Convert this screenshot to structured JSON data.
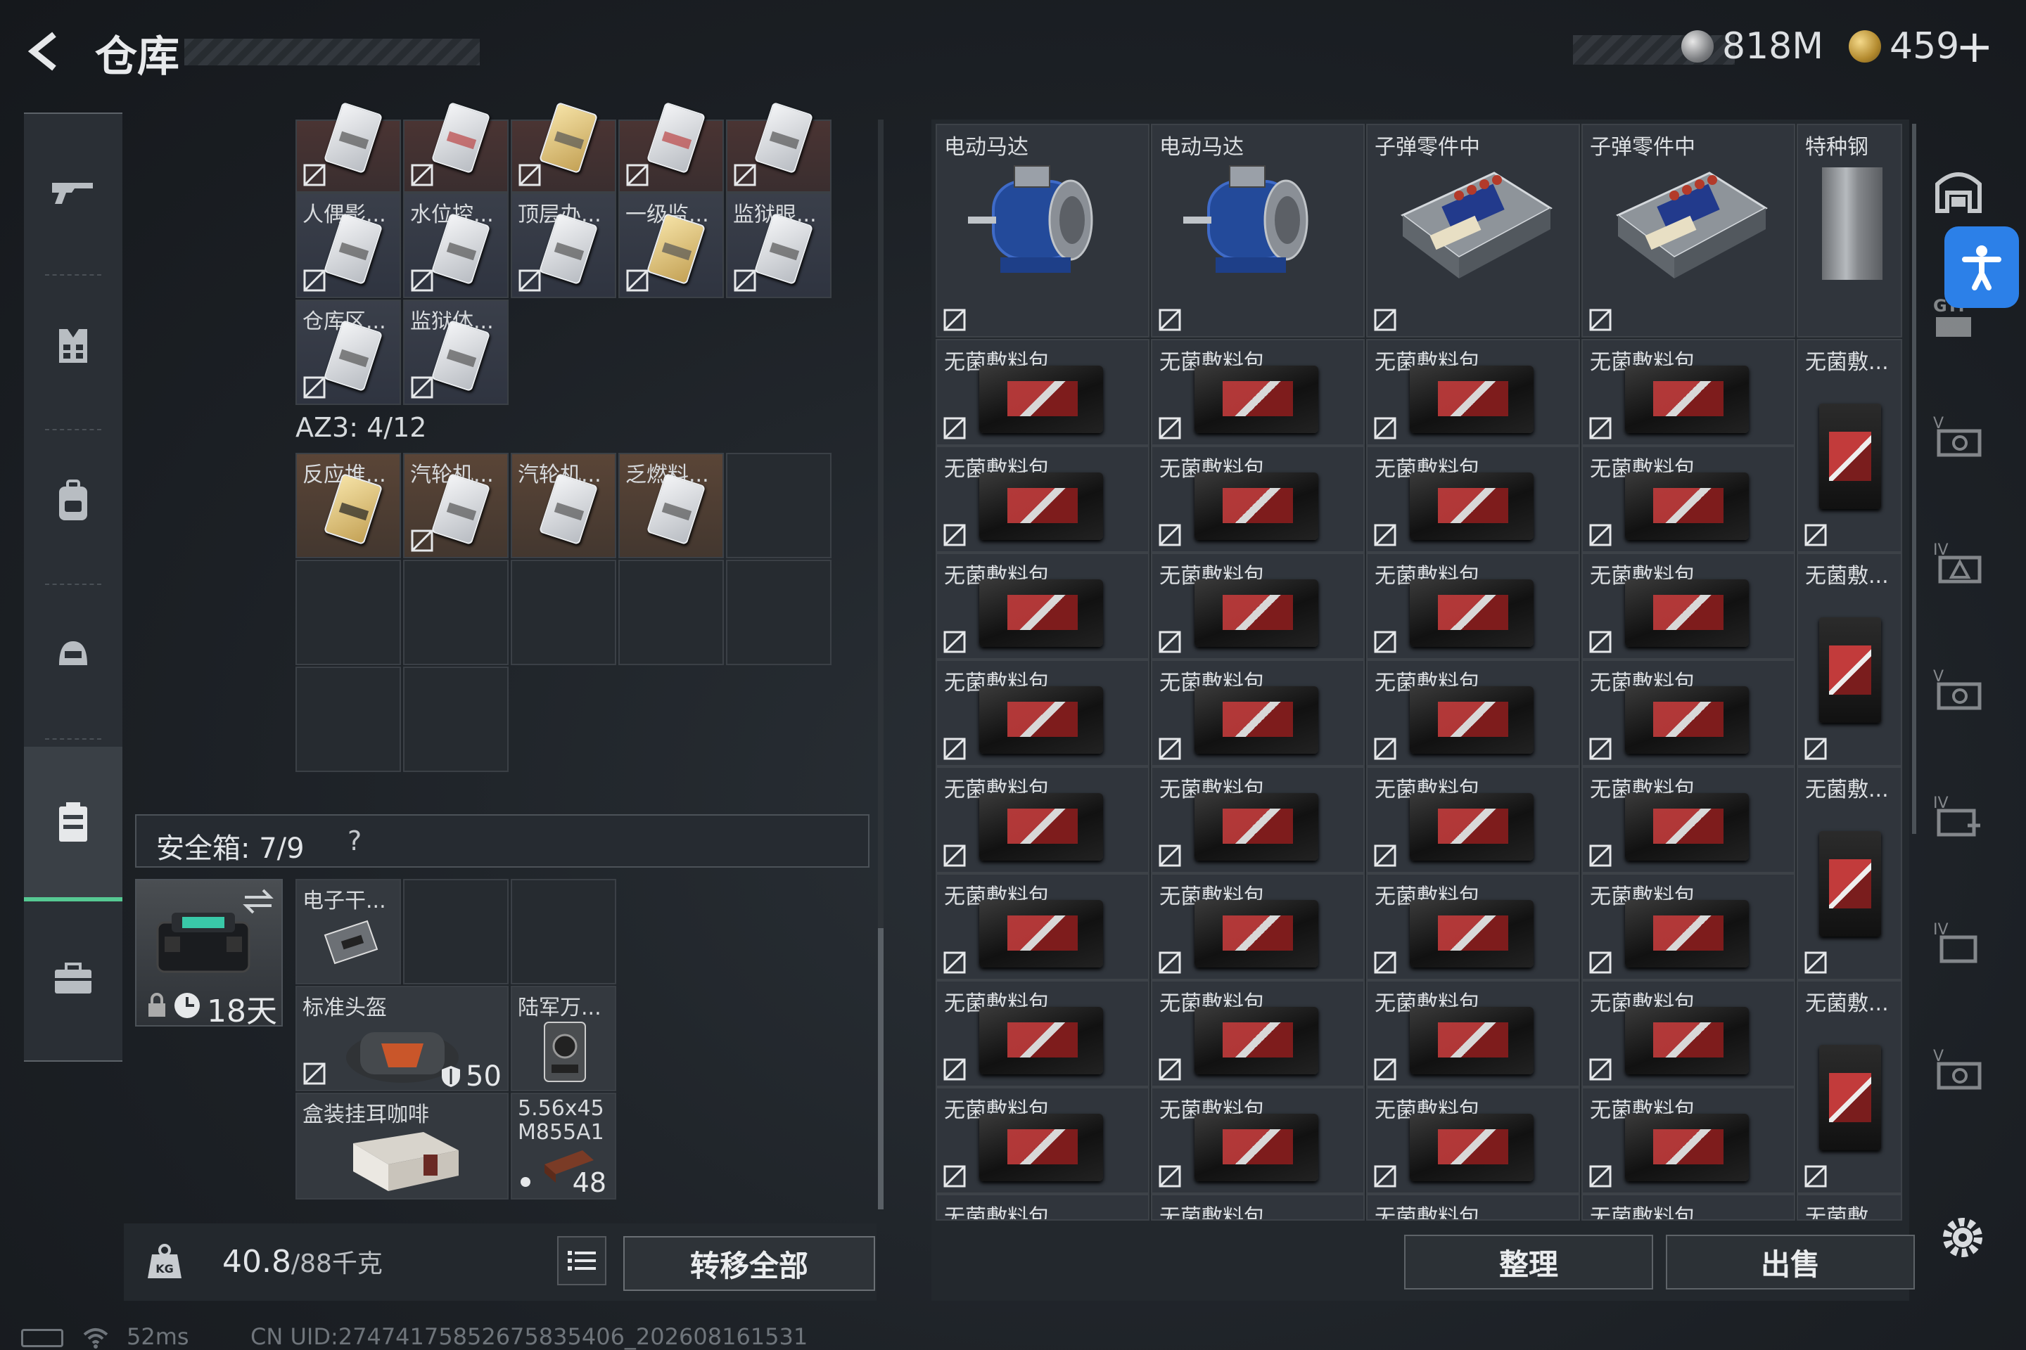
{
  "header": {
    "title": "仓库",
    "currency_silver": "818M",
    "currency_gold": "459",
    "add_label": "+"
  },
  "left_nav": {
    "items": [
      {
        "name": "weapons",
        "icon": "gun-icon"
      },
      {
        "name": "armor",
        "icon": "vest-icon"
      },
      {
        "name": "backpack",
        "icon": "backpack-icon"
      },
      {
        "name": "helmet",
        "icon": "helmet-icon"
      },
      {
        "name": "storage",
        "icon": "container-icon",
        "active": true
      },
      {
        "name": "briefcase",
        "icon": "briefcase-icon"
      }
    ]
  },
  "keycards_grid": {
    "rows": [
      [
        {
          "label": "",
          "style": "red"
        },
        {
          "label": "",
          "style": "red"
        },
        {
          "label": "",
          "style": "red"
        },
        {
          "label": "",
          "style": "red"
        },
        {
          "label": "",
          "style": "red"
        }
      ],
      [
        {
          "label": "人偶影...",
          "style": "blue"
        },
        {
          "label": "水位控...",
          "style": "blue"
        },
        {
          "label": "顶层办...",
          "style": "blue"
        },
        {
          "label": "一级监...",
          "style": "blue"
        },
        {
          "label": "监狱眼...",
          "style": "blue"
        }
      ],
      [
        {
          "label": "仓库区...",
          "style": "blue"
        },
        {
          "label": "监狱体...",
          "style": "blue"
        }
      ]
    ]
  },
  "az3": {
    "label": "AZ3: 4/12",
    "items": [
      {
        "label": "反应堆...",
        "style": "orange"
      },
      {
        "label": "汽轮机...",
        "style": "orange"
      },
      {
        "label": "汽轮机...",
        "style": "orange"
      },
      {
        "label": "乏燃料...",
        "style": "orange"
      }
    ]
  },
  "safe_box": {
    "label": "安全箱: 7/9",
    "help": "?",
    "timer": "18天",
    "items": {
      "electronic": "电子干...",
      "helmet": "标准头盔",
      "helmet_value": "50",
      "army": "陆军万...",
      "coffee": "盒装挂耳咖啡",
      "ammo_name": "5.56x45 M855A1",
      "ammo_count": "48"
    }
  },
  "bottom_left": {
    "weight_current": "40.8",
    "weight_max": "/88千克",
    "transfer_all": "转移全部"
  },
  "warehouse": {
    "top_row": [
      {
        "label": "电动马达",
        "kind": "motor"
      },
      {
        "label": "电动马达",
        "kind": "motor"
      },
      {
        "label": "子弹零件中",
        "kind": "ammo"
      },
      {
        "label": "子弹零件中",
        "kind": "ammo"
      },
      {
        "label": "特种钢",
        "kind": "steel"
      }
    ],
    "bag_label": "无菌敷料包",
    "bag_label_short": "无菌敷...",
    "sort": "整理",
    "sell": "出售"
  },
  "status_bar": {
    "ping": "52ms",
    "uid": "CN UID:2747417585267583540​6_202608161531"
  }
}
